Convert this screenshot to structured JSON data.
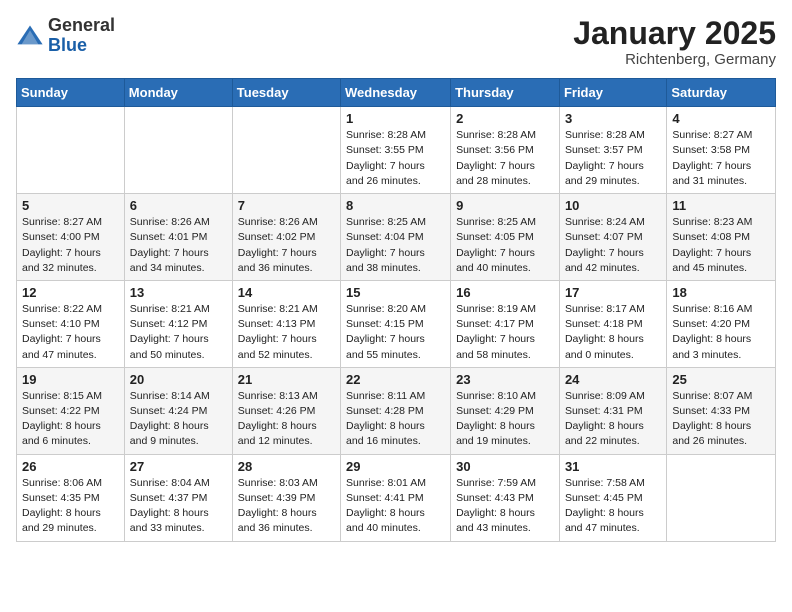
{
  "logo": {
    "general": "General",
    "blue": "Blue"
  },
  "title": "January 2025",
  "location": "Richtenberg, Germany",
  "weekdays": [
    "Sunday",
    "Monday",
    "Tuesday",
    "Wednesday",
    "Thursday",
    "Friday",
    "Saturday"
  ],
  "weeks": [
    [
      {
        "day": "",
        "info": ""
      },
      {
        "day": "",
        "info": ""
      },
      {
        "day": "",
        "info": ""
      },
      {
        "day": "1",
        "info": "Sunrise: 8:28 AM\nSunset: 3:55 PM\nDaylight: 7 hours\nand 26 minutes."
      },
      {
        "day": "2",
        "info": "Sunrise: 8:28 AM\nSunset: 3:56 PM\nDaylight: 7 hours\nand 28 minutes."
      },
      {
        "day": "3",
        "info": "Sunrise: 8:28 AM\nSunset: 3:57 PM\nDaylight: 7 hours\nand 29 minutes."
      },
      {
        "day": "4",
        "info": "Sunrise: 8:27 AM\nSunset: 3:58 PM\nDaylight: 7 hours\nand 31 minutes."
      }
    ],
    [
      {
        "day": "5",
        "info": "Sunrise: 8:27 AM\nSunset: 4:00 PM\nDaylight: 7 hours\nand 32 minutes."
      },
      {
        "day": "6",
        "info": "Sunrise: 8:26 AM\nSunset: 4:01 PM\nDaylight: 7 hours\nand 34 minutes."
      },
      {
        "day": "7",
        "info": "Sunrise: 8:26 AM\nSunset: 4:02 PM\nDaylight: 7 hours\nand 36 minutes."
      },
      {
        "day": "8",
        "info": "Sunrise: 8:25 AM\nSunset: 4:04 PM\nDaylight: 7 hours\nand 38 minutes."
      },
      {
        "day": "9",
        "info": "Sunrise: 8:25 AM\nSunset: 4:05 PM\nDaylight: 7 hours\nand 40 minutes."
      },
      {
        "day": "10",
        "info": "Sunrise: 8:24 AM\nSunset: 4:07 PM\nDaylight: 7 hours\nand 42 minutes."
      },
      {
        "day": "11",
        "info": "Sunrise: 8:23 AM\nSunset: 4:08 PM\nDaylight: 7 hours\nand 45 minutes."
      }
    ],
    [
      {
        "day": "12",
        "info": "Sunrise: 8:22 AM\nSunset: 4:10 PM\nDaylight: 7 hours\nand 47 minutes."
      },
      {
        "day": "13",
        "info": "Sunrise: 8:21 AM\nSunset: 4:12 PM\nDaylight: 7 hours\nand 50 minutes."
      },
      {
        "day": "14",
        "info": "Sunrise: 8:21 AM\nSunset: 4:13 PM\nDaylight: 7 hours\nand 52 minutes."
      },
      {
        "day": "15",
        "info": "Sunrise: 8:20 AM\nSunset: 4:15 PM\nDaylight: 7 hours\nand 55 minutes."
      },
      {
        "day": "16",
        "info": "Sunrise: 8:19 AM\nSunset: 4:17 PM\nDaylight: 7 hours\nand 58 minutes."
      },
      {
        "day": "17",
        "info": "Sunrise: 8:17 AM\nSunset: 4:18 PM\nDaylight: 8 hours\nand 0 minutes."
      },
      {
        "day": "18",
        "info": "Sunrise: 8:16 AM\nSunset: 4:20 PM\nDaylight: 8 hours\nand 3 minutes."
      }
    ],
    [
      {
        "day": "19",
        "info": "Sunrise: 8:15 AM\nSunset: 4:22 PM\nDaylight: 8 hours\nand 6 minutes."
      },
      {
        "day": "20",
        "info": "Sunrise: 8:14 AM\nSunset: 4:24 PM\nDaylight: 8 hours\nand 9 minutes."
      },
      {
        "day": "21",
        "info": "Sunrise: 8:13 AM\nSunset: 4:26 PM\nDaylight: 8 hours\nand 12 minutes."
      },
      {
        "day": "22",
        "info": "Sunrise: 8:11 AM\nSunset: 4:28 PM\nDaylight: 8 hours\nand 16 minutes."
      },
      {
        "day": "23",
        "info": "Sunrise: 8:10 AM\nSunset: 4:29 PM\nDaylight: 8 hours\nand 19 minutes."
      },
      {
        "day": "24",
        "info": "Sunrise: 8:09 AM\nSunset: 4:31 PM\nDaylight: 8 hours\nand 22 minutes."
      },
      {
        "day": "25",
        "info": "Sunrise: 8:07 AM\nSunset: 4:33 PM\nDaylight: 8 hours\nand 26 minutes."
      }
    ],
    [
      {
        "day": "26",
        "info": "Sunrise: 8:06 AM\nSunset: 4:35 PM\nDaylight: 8 hours\nand 29 minutes."
      },
      {
        "day": "27",
        "info": "Sunrise: 8:04 AM\nSunset: 4:37 PM\nDaylight: 8 hours\nand 33 minutes."
      },
      {
        "day": "28",
        "info": "Sunrise: 8:03 AM\nSunset: 4:39 PM\nDaylight: 8 hours\nand 36 minutes."
      },
      {
        "day": "29",
        "info": "Sunrise: 8:01 AM\nSunset: 4:41 PM\nDaylight: 8 hours\nand 40 minutes."
      },
      {
        "day": "30",
        "info": "Sunrise: 7:59 AM\nSunset: 4:43 PM\nDaylight: 8 hours\nand 43 minutes."
      },
      {
        "day": "31",
        "info": "Sunrise: 7:58 AM\nSunset: 4:45 PM\nDaylight: 8 hours\nand 47 minutes."
      },
      {
        "day": "",
        "info": ""
      }
    ]
  ]
}
